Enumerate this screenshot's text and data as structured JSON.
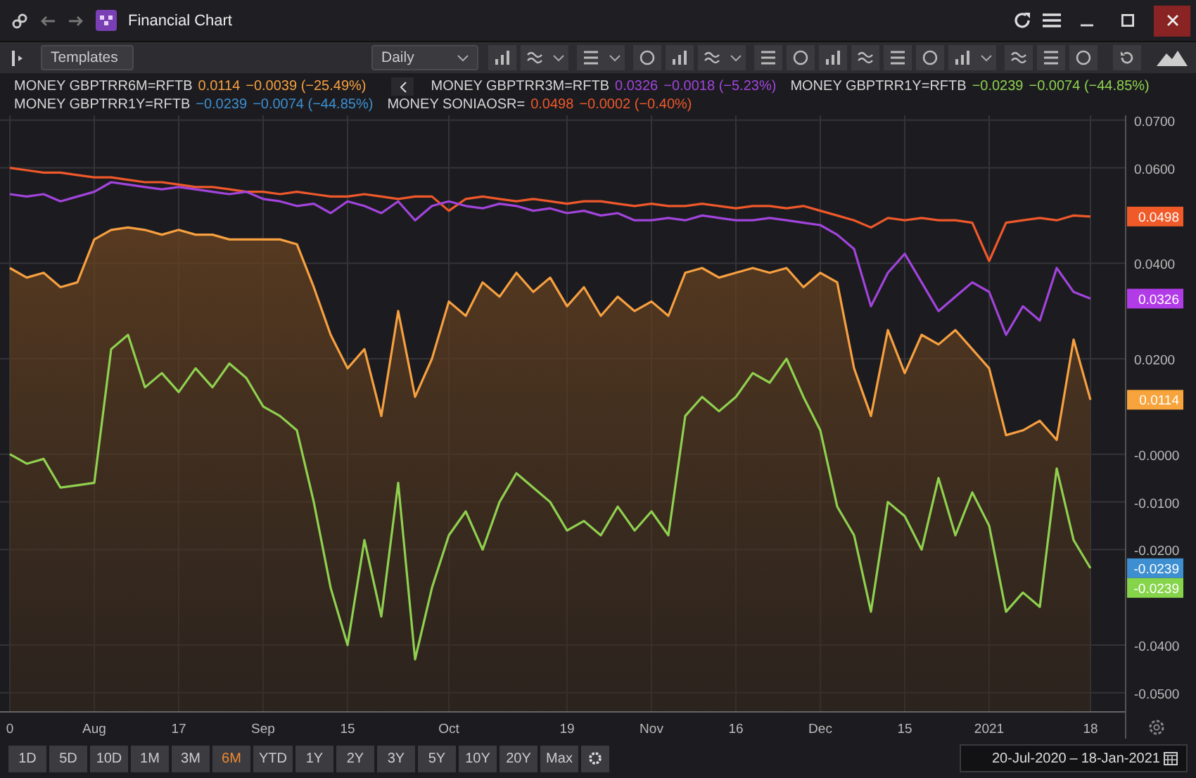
{
  "window": {
    "title": "Financial Chart"
  },
  "toolbar": {
    "templates": "Templates",
    "interval": "Daily"
  },
  "legend_rows": [
    [
      {
        "name": "MONEY GBPTRR6M=RFTB",
        "value": "0.0114",
        "change": "−0.0039 (−25.49%)",
        "color": "#f7a040"
      },
      {
        "name": "MONEY GBPTRR3M=RFTB",
        "value": "0.0326",
        "change": "−0.0018 (−5.23%)",
        "color": "#a244dc"
      },
      {
        "name": "MONEY GBPTRR1Y=RFTB",
        "value": "−0.0239",
        "change": "−0.0074 (−44.85%)",
        "color": "#8fd14f"
      }
    ],
    [
      {
        "name": "MONEY GBPTRR1Y=RFTB",
        "value": "−0.0239",
        "change": "−0.0074 (−44.85%)",
        "color": "#3d8fd1"
      },
      {
        "name": "MONEY SONIAOSR=",
        "value": "0.0498",
        "change": "−0.0002 (−0.40%)",
        "color": "#f0582a"
      }
    ]
  ],
  "chart_data": {
    "type": "line",
    "categories": [
      "0",
      null,
      null,
      null,
      null,
      "Aug",
      null,
      null,
      null,
      null,
      "17",
      null,
      null,
      null,
      null,
      "Sep",
      null,
      null,
      null,
      null,
      "15",
      null,
      null,
      null,
      null,
      null,
      "Oct",
      null,
      null,
      null,
      null,
      null,
      null,
      "19",
      null,
      null,
      null,
      null,
      "Nov",
      null,
      null,
      null,
      null,
      "16",
      null,
      null,
      null,
      null,
      "Dec",
      null,
      null,
      null,
      null,
      "15",
      null,
      null,
      null,
      null,
      "2021",
      null,
      null,
      null,
      null,
      null,
      "18"
    ],
    "series": [
      {
        "color": "#f7a040",
        "values": [
          0.039,
          0.037,
          0.038,
          0.035,
          0.036,
          0.045,
          0.047,
          0.0475,
          0.047,
          0.046,
          0.047,
          0.046,
          0.046,
          0.045,
          0.045,
          0.045,
          0.045,
          0.044,
          0.035,
          0.025,
          0.018,
          0.022,
          0.008,
          0.03,
          0.012,
          0.02,
          0.032,
          0.029,
          0.036,
          0.033,
          0.038,
          0.034,
          0.037,
          0.031,
          0.035,
          0.029,
          0.033,
          0.03,
          0.032,
          0.029,
          0.038,
          0.039,
          0.037,
          0.038,
          0.039,
          0.038,
          0.039,
          0.035,
          0.038,
          0.036,
          0.018,
          0.008,
          0.026,
          0.017,
          0.025,
          0.023,
          0.026,
          0.022,
          0.018,
          0.004,
          0.005,
          0.007,
          0.003,
          0.024,
          0.0114
        ]
      },
      {
        "color": "#a244dc",
        "values": [
          0.0545,
          0.054,
          0.0545,
          0.053,
          0.054,
          0.055,
          0.057,
          0.0565,
          0.056,
          0.0555,
          0.056,
          0.0555,
          0.055,
          0.0545,
          0.055,
          0.0535,
          0.053,
          0.052,
          0.0525,
          0.0505,
          0.053,
          0.052,
          0.0505,
          0.053,
          0.049,
          0.052,
          0.053,
          0.052,
          0.0515,
          0.0525,
          0.052,
          0.051,
          0.0515,
          0.0505,
          0.051,
          0.05,
          0.0505,
          0.049,
          0.049,
          0.0495,
          0.049,
          0.05,
          0.0495,
          0.049,
          0.049,
          0.0495,
          0.049,
          0.0485,
          0.048,
          0.046,
          0.043,
          0.031,
          0.038,
          0.042,
          0.036,
          0.03,
          0.033,
          0.036,
          0.034,
          0.025,
          0.031,
          0.028,
          0.039,
          0.034,
          0.0326
        ]
      },
      {
        "color": "#8fd14f",
        "values": [
          0.0,
          -0.002,
          -0.001,
          -0.007,
          -0.0065,
          -0.006,
          0.022,
          0.025,
          0.014,
          0.017,
          0.013,
          0.018,
          0.014,
          0.019,
          0.016,
          0.01,
          0.008,
          0.005,
          -0.01,
          -0.028,
          -0.04,
          -0.018,
          -0.034,
          -0.006,
          -0.043,
          -0.028,
          -0.017,
          -0.012,
          -0.02,
          -0.01,
          -0.004,
          -0.007,
          -0.01,
          -0.016,
          -0.014,
          -0.017,
          -0.011,
          -0.016,
          -0.012,
          -0.017,
          0.008,
          0.012,
          0.009,
          0.012,
          0.017,
          0.015,
          0.02,
          0.012,
          0.005,
          -0.011,
          -0.017,
          -0.033,
          -0.01,
          -0.013,
          -0.02,
          -0.005,
          -0.017,
          -0.008,
          -0.015,
          -0.033,
          -0.029,
          -0.032,
          -0.003,
          -0.018,
          -0.0239
        ]
      },
      {
        "color": "#f0582a",
        "values": [
          0.06,
          0.0595,
          0.059,
          0.059,
          0.0585,
          0.058,
          0.058,
          0.0575,
          0.057,
          0.057,
          0.0565,
          0.056,
          0.056,
          0.0555,
          0.055,
          0.055,
          0.0545,
          0.055,
          0.0545,
          0.054,
          0.054,
          0.0545,
          0.054,
          0.0535,
          0.054,
          0.054,
          0.051,
          0.0535,
          0.054,
          0.0535,
          0.053,
          0.0535,
          0.053,
          0.0525,
          0.053,
          0.053,
          0.0525,
          0.052,
          0.0525,
          0.052,
          0.052,
          0.0525,
          0.052,
          0.0515,
          0.052,
          0.052,
          0.0515,
          0.052,
          0.051,
          0.05,
          0.049,
          0.0475,
          0.0495,
          0.049,
          0.0495,
          0.049,
          0.049,
          0.0485,
          0.0405,
          0.0485,
          0.049,
          0.0495,
          0.049,
          0.05,
          0.0498
        ]
      }
    ],
    "ylim": [
      -0.054,
      0.071
    ],
    "grid": true,
    "yticks": [
      {
        "value": 0.07,
        "label": "0.0700"
      },
      {
        "value": 0.06,
        "label": "0.0600"
      },
      {
        "value": 0.04,
        "label": "0.0400"
      },
      {
        "value": 0.02,
        "label": "0.0200"
      },
      {
        "value": 0,
        "label": "-0.0000"
      },
      {
        "value": -0.01,
        "label": "-0.0100"
      },
      {
        "value": -0.02,
        "label": "-0.0200"
      },
      {
        "value": -0.04,
        "label": "-0.0400"
      },
      {
        "value": -0.05,
        "label": "-0.0500"
      }
    ]
  },
  "price_labels": [
    {
      "text": "0.0498",
      "color": "#f05a28"
    },
    {
      "text": "0.0326",
      "color": "#b23be8"
    },
    {
      "text": "0.0114",
      "color": "#f7a43c"
    },
    {
      "text": "-0.0239",
      "color": "#3d8fd1"
    },
    {
      "text": "-0.0239",
      "color": "#86d44a"
    }
  ],
  "periods": [
    {
      "label": "1D",
      "selected": false
    },
    {
      "label": "5D",
      "selected": false
    },
    {
      "label": "10D",
      "selected": false
    },
    {
      "label": "1M",
      "selected": false
    },
    {
      "label": "3M",
      "selected": false
    },
    {
      "label": "6M",
      "selected": true
    },
    {
      "label": "YTD",
      "selected": false
    },
    {
      "label": "1Y",
      "selected": false
    },
    {
      "label": "2Y",
      "selected": false
    },
    {
      "label": "3Y",
      "selected": false
    },
    {
      "label": "5Y",
      "selected": false
    },
    {
      "label": "10Y",
      "selected": false
    },
    {
      "label": "20Y",
      "selected": false
    },
    {
      "label": "Max",
      "selected": false
    }
  ],
  "date_range": {
    "from": "20-Jul-2020",
    "separator": "–",
    "to": "18-Jan-2021"
  }
}
